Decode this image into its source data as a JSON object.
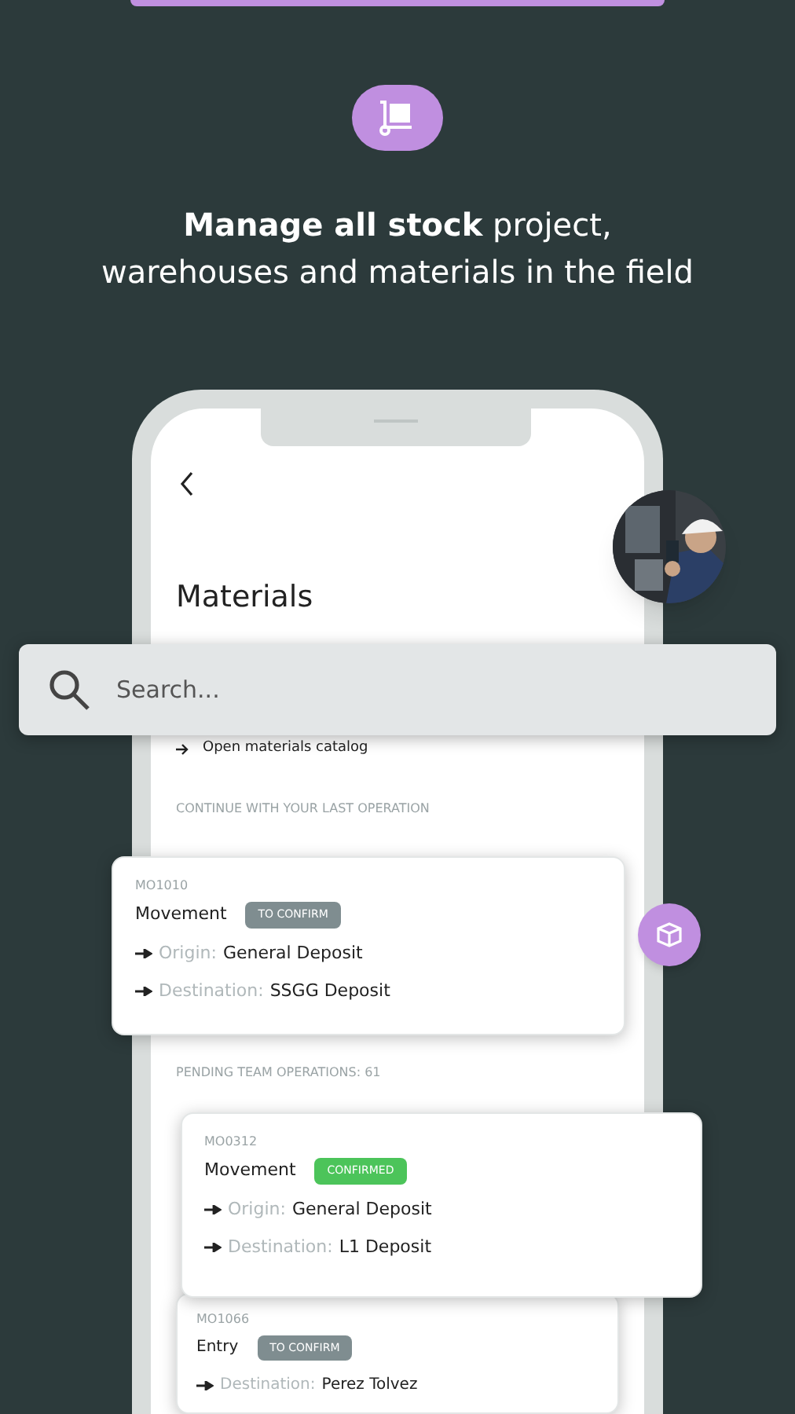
{
  "headline": "**Manage all stock** project,\nwarehouses and materials in the field",
  "screen": {
    "title": "Materials",
    "search": {
      "placeholder": "Search..."
    },
    "catalog_link": "Open materials catalog",
    "last_operation_heading": "CONTINUE WITH YOUR LAST OPERATION",
    "pending_heading": "PENDING TEAM OPERATIONS: 61"
  },
  "operations": [
    {
      "code": "MO1010",
      "type": "Movement",
      "status": {
        "label": "TO CONFIRM",
        "kind": "pending"
      },
      "lines": [
        {
          "label": "Origin:",
          "value": "General Deposit"
        },
        {
          "label": "Destination:",
          "value": "SSGG Deposit"
        }
      ]
    },
    {
      "code": "MO0312",
      "type": "Movement",
      "status": {
        "label": "CONFIRMED",
        "kind": "confirmed"
      },
      "lines": [
        {
          "label": "Origin:",
          "value": "General Deposit"
        },
        {
          "label": "Destination:",
          "value": "L1 Deposit"
        }
      ]
    },
    {
      "code": "MO1066",
      "type": "Entry",
      "status": {
        "label": "TO CONFIRM",
        "kind": "pending"
      },
      "lines": [
        {
          "label": "Destination:",
          "value": "Perez Tolvez"
        }
      ]
    }
  ]
}
